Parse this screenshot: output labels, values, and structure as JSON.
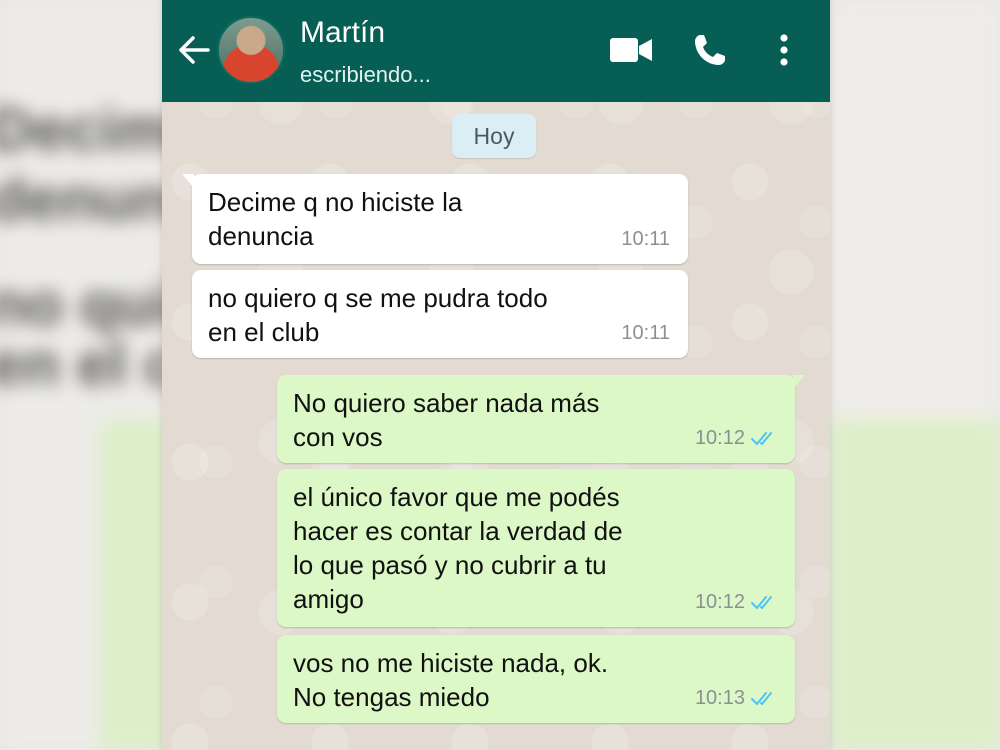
{
  "header": {
    "contact_name": "Martín",
    "status": "escribiendo...",
    "icons": [
      "back-arrow-icon",
      "avatar",
      "video-call-icon",
      "phone-call-icon",
      "more-options-icon"
    ],
    "background_color": "#075e54"
  },
  "date_chip": "Hoy",
  "messages": [
    {
      "direction": "incoming",
      "text": "Decime q no hiciste la\ndenuncia",
      "time": "10:11"
    },
    {
      "direction": "incoming",
      "text": "no quiero q se me pudra todo\nen el club",
      "time": "10:11"
    },
    {
      "direction": "outgoing",
      "text": "No quiero saber nada más\ncon vos",
      "time": "10:12",
      "status_icon": "double-check-read-icon"
    },
    {
      "direction": "outgoing",
      "text": "el único favor que me podés\nhacer es contar la verdad de\nlo que pasó y no cubrir a tu\namigo",
      "time": "10:12",
      "status_icon": "double-check-read-icon"
    },
    {
      "direction": "outgoing",
      "text": "vos no me hiciste nada, ok.\nNo tengas miedo",
      "time": "10:13",
      "status_icon": "double-check-read-icon"
    }
  ],
  "colors": {
    "incoming_bubble": "#ffffff",
    "outgoing_bubble": "#dcf8c6",
    "read_ticks": "#4fc3f7",
    "wallpaper": "#e5ddd5"
  }
}
